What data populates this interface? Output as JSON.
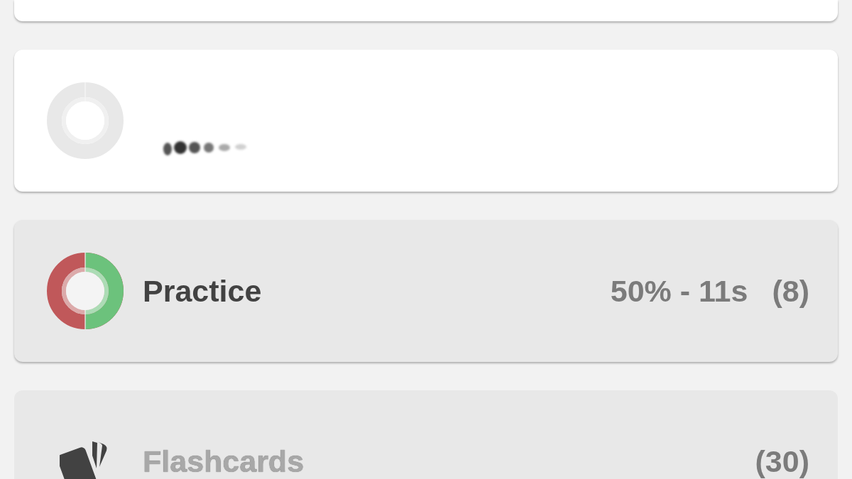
{
  "cards": [
    {
      "kind": "blank",
      "dimmed": false
    },
    {
      "kind": "quiz",
      "dimmed": false,
      "attempted": false,
      "blurred": true
    },
    {
      "kind": "quiz",
      "dimmed": true,
      "attempted": true,
      "level": 0.5,
      "title": "Practice",
      "score": "50% - 11s",
      "count": "(8)"
    },
    {
      "kind": "flashcards",
      "dimmed": true,
      "faded": true,
      "title": "Flashcards",
      "count": "(30)"
    }
  ]
}
